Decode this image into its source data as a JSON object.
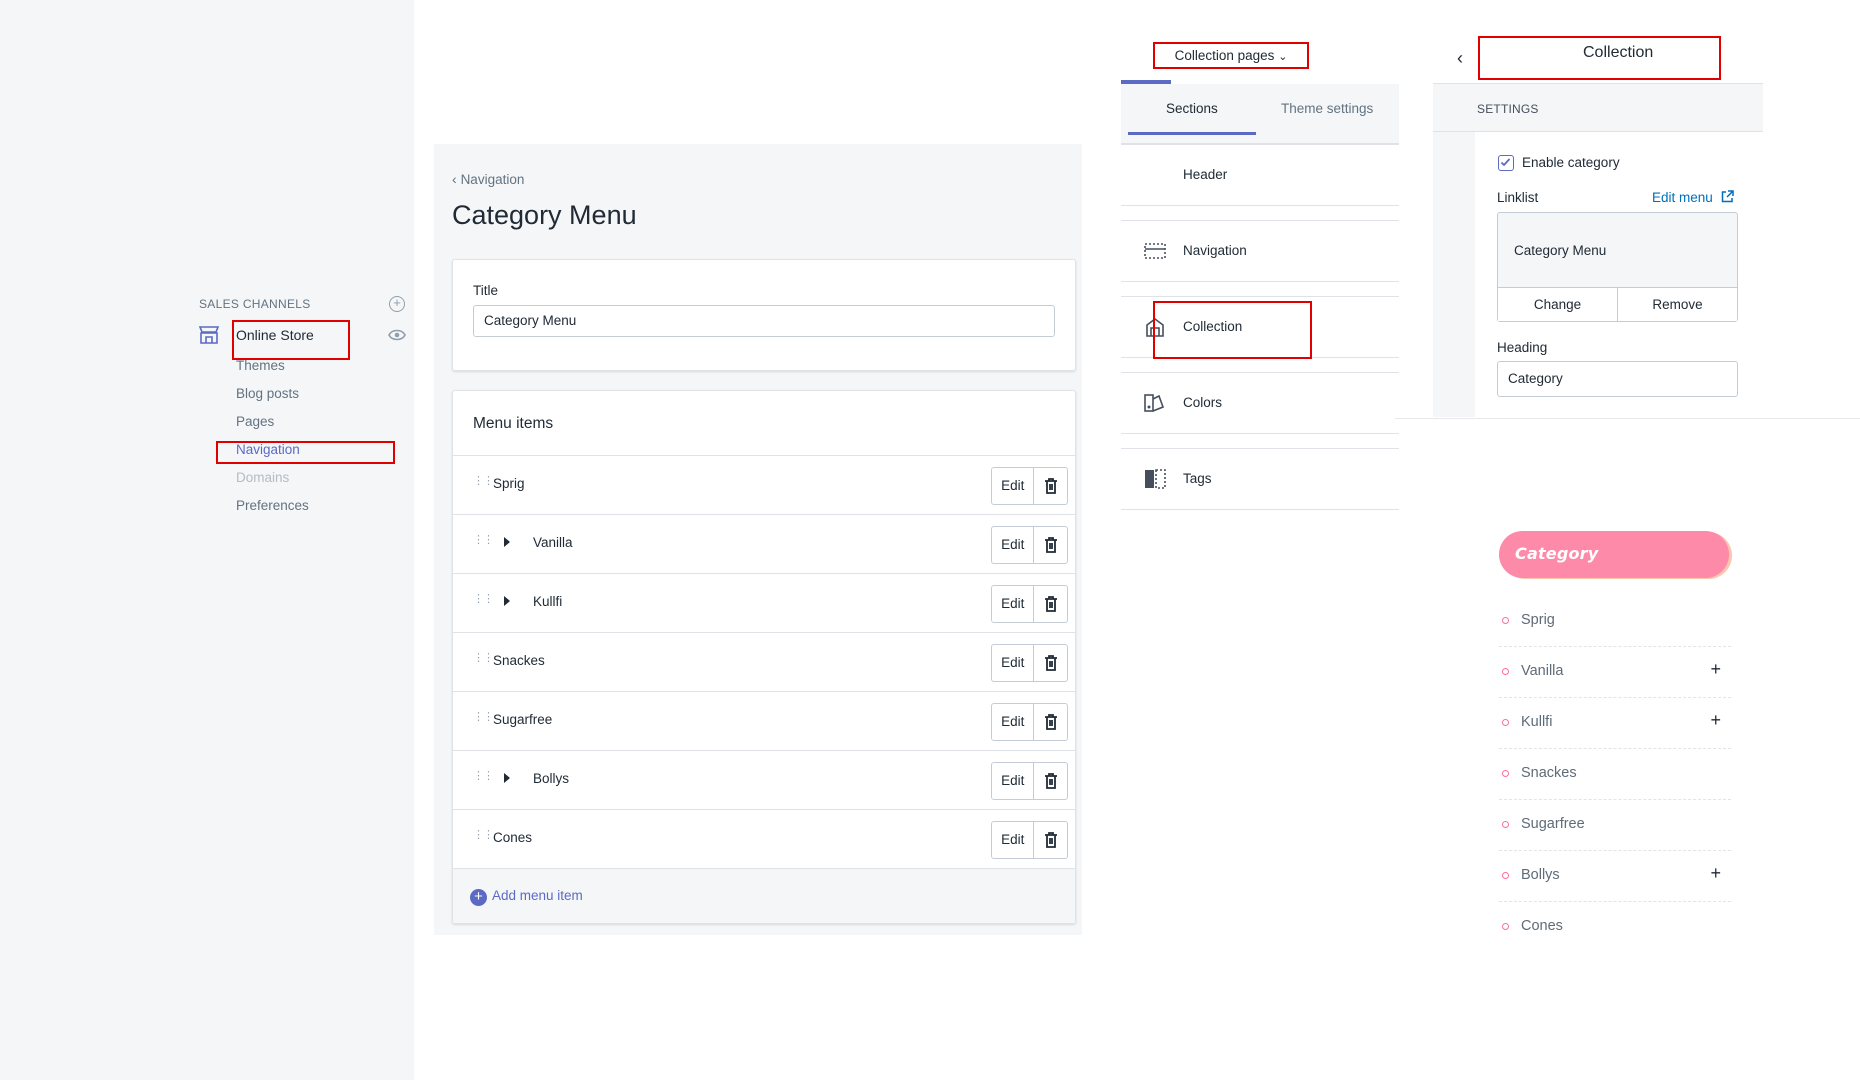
{
  "sidebar": {
    "section_heading": "SALES CHANNELS",
    "store_label": "Online Store",
    "sub_items": [
      "Themes",
      "Blog posts",
      "Pages",
      "Navigation",
      "Domains",
      "Preferences"
    ]
  },
  "menu_editor": {
    "back_label": "Navigation",
    "page_title": "Category Menu",
    "title_label": "Title",
    "title_value": "Category Menu",
    "menu_items_heading": "Menu items",
    "items": [
      {
        "label": "Sprig",
        "expandable": false
      },
      {
        "label": "Vanilla",
        "expandable": true
      },
      {
        "label": "Kullfi",
        "expandable": true
      },
      {
        "label": "Snackes",
        "expandable": false
      },
      {
        "label": "Sugarfree",
        "expandable": false
      },
      {
        "label": "Bollys",
        "expandable": true
      },
      {
        "label": "Cones",
        "expandable": false
      }
    ],
    "edit_label": "Edit",
    "add_label": "Add menu item"
  },
  "theme_editor": {
    "page_select": "Collection pages",
    "tabs": [
      "Sections",
      "Theme settings"
    ],
    "sections": [
      "Header",
      "Navigation",
      "Collection",
      "Colors",
      "Tags"
    ]
  },
  "collection_settings": {
    "title": "Collection",
    "settings_label": "SETTINGS",
    "enable_label": "Enable category",
    "linklist_label": "Linklist",
    "edit_menu_label": "Edit menu",
    "menu_name": "Category Menu",
    "change_label": "Change",
    "remove_label": "Remove",
    "heading_label": "Heading",
    "heading_value": "Category"
  },
  "preview": {
    "heading": "Category",
    "items": [
      {
        "label": "Sprig",
        "has_children": false
      },
      {
        "label": "Vanilla",
        "has_children": true
      },
      {
        "label": "Kullfi",
        "has_children": true
      },
      {
        "label": "Snackes",
        "has_children": false
      },
      {
        "label": "Sugarfree",
        "has_children": false
      },
      {
        "label": "Bollys",
        "has_children": true
      },
      {
        "label": "Cones",
        "has_children": false
      }
    ]
  },
  "colors": {
    "accent": "#5c6ac4",
    "highlight": "#e00000",
    "pill": "#fc8aa8",
    "link": "#006fbb"
  }
}
